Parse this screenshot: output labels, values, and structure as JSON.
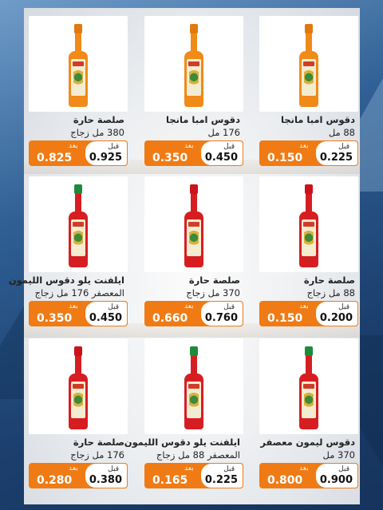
{
  "labels": {
    "after": "بعد",
    "before": "قبل"
  },
  "colors": {
    "accent": "#f07b14",
    "background": "#1c3f6e"
  },
  "products": [
    {
      "line1": "دقوس امبا مانجا",
      "line2": "88 مل",
      "after": "0.150",
      "before": "0.225",
      "cap": "#e07a10",
      "body": "#f08a18"
    },
    {
      "line1": "دقوس امبا مانجا",
      "line2": "176 مل",
      "after": "0.350",
      "before": "0.450",
      "cap": "#e07a10",
      "body": "#f08a18"
    },
    {
      "line1": "صلصة حارة",
      "line2": "380  مل زجاج",
      "after": "0.825",
      "before": "0.925",
      "cap": "#e07a10",
      "body": "#f08a18"
    },
    {
      "line1": "صلصة حارة",
      "line2": "88 مل زجاج",
      "after": "0.150",
      "before": "0.200",
      "cap": "#c8141a",
      "body": "#d61e22"
    },
    {
      "line1": "صلصة حارة",
      "line2": "370 مل زجاج",
      "after": "0.660",
      "before": "0.760",
      "cap": "#c8141a",
      "body": "#d61e22"
    },
    {
      "line1": "ايلفنت يلو دقوس الليمون",
      "line2": "المعصفر  176 مل زجاج",
      "after": "0.350",
      "before": "0.450",
      "cap": "#1e8a3c",
      "body": "#d61e22"
    },
    {
      "line1": "دقوس ليمون معصفر",
      "line2": "370 مل",
      "after": "0.800",
      "before": "0.900",
      "cap": "#1e8a3c",
      "body": "#d61e22"
    },
    {
      "line1": "ايلفنت يلو دقوس الليمون",
      "line2": "المعصفر 88 مل زجاج",
      "after": "0.165",
      "before": "0.225",
      "cap": "#1e8a3c",
      "body": "#d61e22"
    },
    {
      "line1": "صلصة حارة",
      "line2": "176 مل زجاج",
      "after": "0.280",
      "before": "0.380",
      "cap": "#c8141a",
      "body": "#d61e22"
    }
  ]
}
